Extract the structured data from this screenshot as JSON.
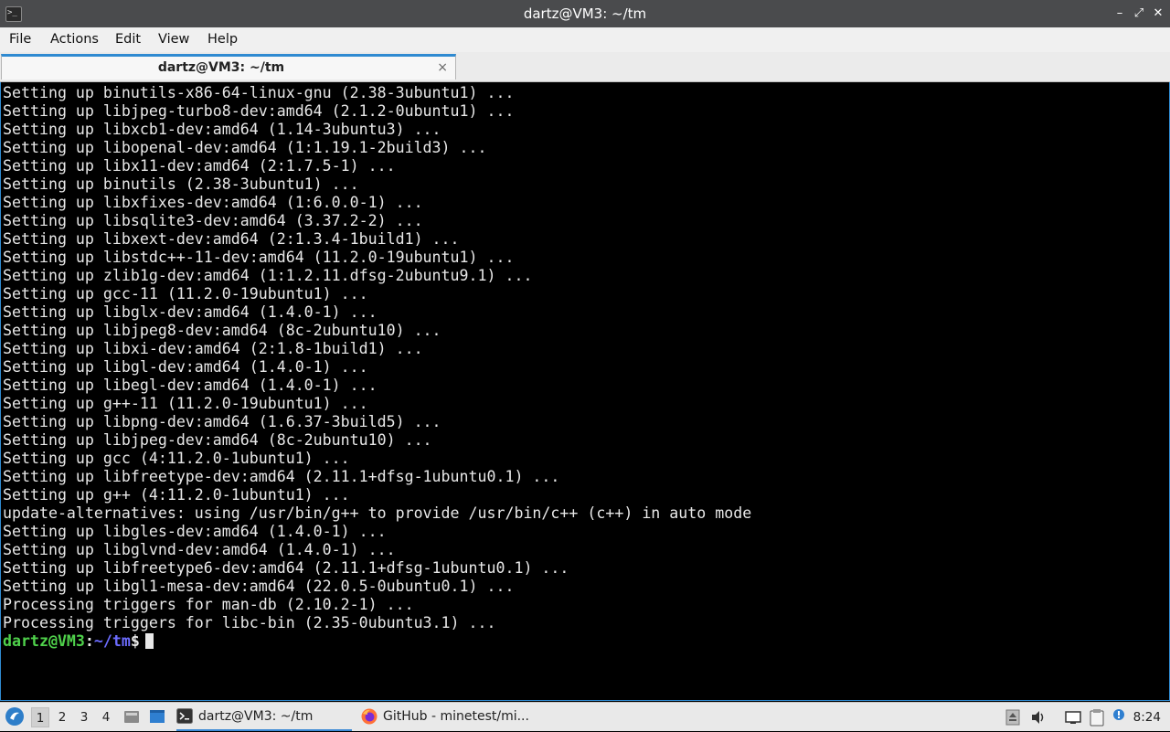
{
  "window": {
    "title": "dartz@VM3: ~/tm",
    "app_icon": "terminal-icon",
    "controls": {
      "minimize": "–",
      "maximize": "⤢",
      "close": "✕"
    }
  },
  "menu": {
    "file": "File",
    "actions": "Actions",
    "edit": "Edit",
    "view": "View",
    "help": "Help"
  },
  "tab": {
    "label": "dartz@VM3: ~/tm",
    "close": "×"
  },
  "terminal": {
    "lines": [
      "Setting up binutils-x86-64-linux-gnu (2.38-3ubuntu1) ...",
      "Setting up libjpeg-turbo8-dev:amd64 (2.1.2-0ubuntu1) ...",
      "Setting up libxcb1-dev:amd64 (1.14-3ubuntu3) ...",
      "Setting up libopenal-dev:amd64 (1:1.19.1-2build3) ...",
      "Setting up libx11-dev:amd64 (2:1.7.5-1) ...",
      "Setting up binutils (2.38-3ubuntu1) ...",
      "Setting up libxfixes-dev:amd64 (1:6.0.0-1) ...",
      "Setting up libsqlite3-dev:amd64 (3.37.2-2) ...",
      "Setting up libxext-dev:amd64 (2:1.3.4-1build1) ...",
      "Setting up libstdc++-11-dev:amd64 (11.2.0-19ubuntu1) ...",
      "Setting up zlib1g-dev:amd64 (1:1.2.11.dfsg-2ubuntu9.1) ...",
      "Setting up gcc-11 (11.2.0-19ubuntu1) ...",
      "Setting up libglx-dev:amd64 (1.4.0-1) ...",
      "Setting up libjpeg8-dev:amd64 (8c-2ubuntu10) ...",
      "Setting up libxi-dev:amd64 (2:1.8-1build1) ...",
      "Setting up libgl-dev:amd64 (1.4.0-1) ...",
      "Setting up libegl-dev:amd64 (1.4.0-1) ...",
      "Setting up g++-11 (11.2.0-19ubuntu1) ...",
      "Setting up libpng-dev:amd64 (1.6.37-3build5) ...",
      "Setting up libjpeg-dev:amd64 (8c-2ubuntu10) ...",
      "Setting up gcc (4:11.2.0-1ubuntu1) ...",
      "Setting up libfreetype-dev:amd64 (2.11.1+dfsg-1ubuntu0.1) ...",
      "Setting up g++ (4:11.2.0-1ubuntu1) ...",
      "update-alternatives: using /usr/bin/g++ to provide /usr/bin/c++ (c++) in auto mode",
      "Setting up libgles-dev:amd64 (1.4.0-1) ...",
      "Setting up libglvnd-dev:amd64 (1.4.0-1) ...",
      "Setting up libfreetype6-dev:amd64 (2.11.1+dfsg-1ubuntu0.1) ...",
      "Setting up libgl1-mesa-dev:amd64 (22.0.5-0ubuntu0.1) ...",
      "Processing triggers for man-db (2.10.2-1) ...",
      "Processing triggers for libc-bin (2.35-0ubuntu3.1) ..."
    ],
    "prompt": {
      "user_host": "dartz@VM3",
      "colon": ":",
      "path": "~/tm",
      "symbol": "$"
    },
    "colors": {
      "background": "#000000",
      "text": "#e8e8e8",
      "prompt_user": "#4fd14b",
      "prompt_path": "#6c6cff"
    }
  },
  "taskbar": {
    "start_icon": "lubuntu-start-icon",
    "workspaces": [
      "1",
      "2",
      "3",
      "4"
    ],
    "active_workspace": "1",
    "quick_launch": [
      "file-manager-icon",
      "show-desktop-icon"
    ],
    "tasks": [
      {
        "icon": "terminal-icon",
        "label": "dartz@VM3: ~/tm",
        "active": true
      },
      {
        "icon": "firefox-icon",
        "label": "GitHub - minetest/mi...",
        "active": false
      }
    ],
    "tray_icons": [
      "update-notifier-icon",
      "volume-icon",
      "network-icon",
      "clipboard-icon",
      "notification-icon"
    ],
    "clock": "8:24"
  }
}
